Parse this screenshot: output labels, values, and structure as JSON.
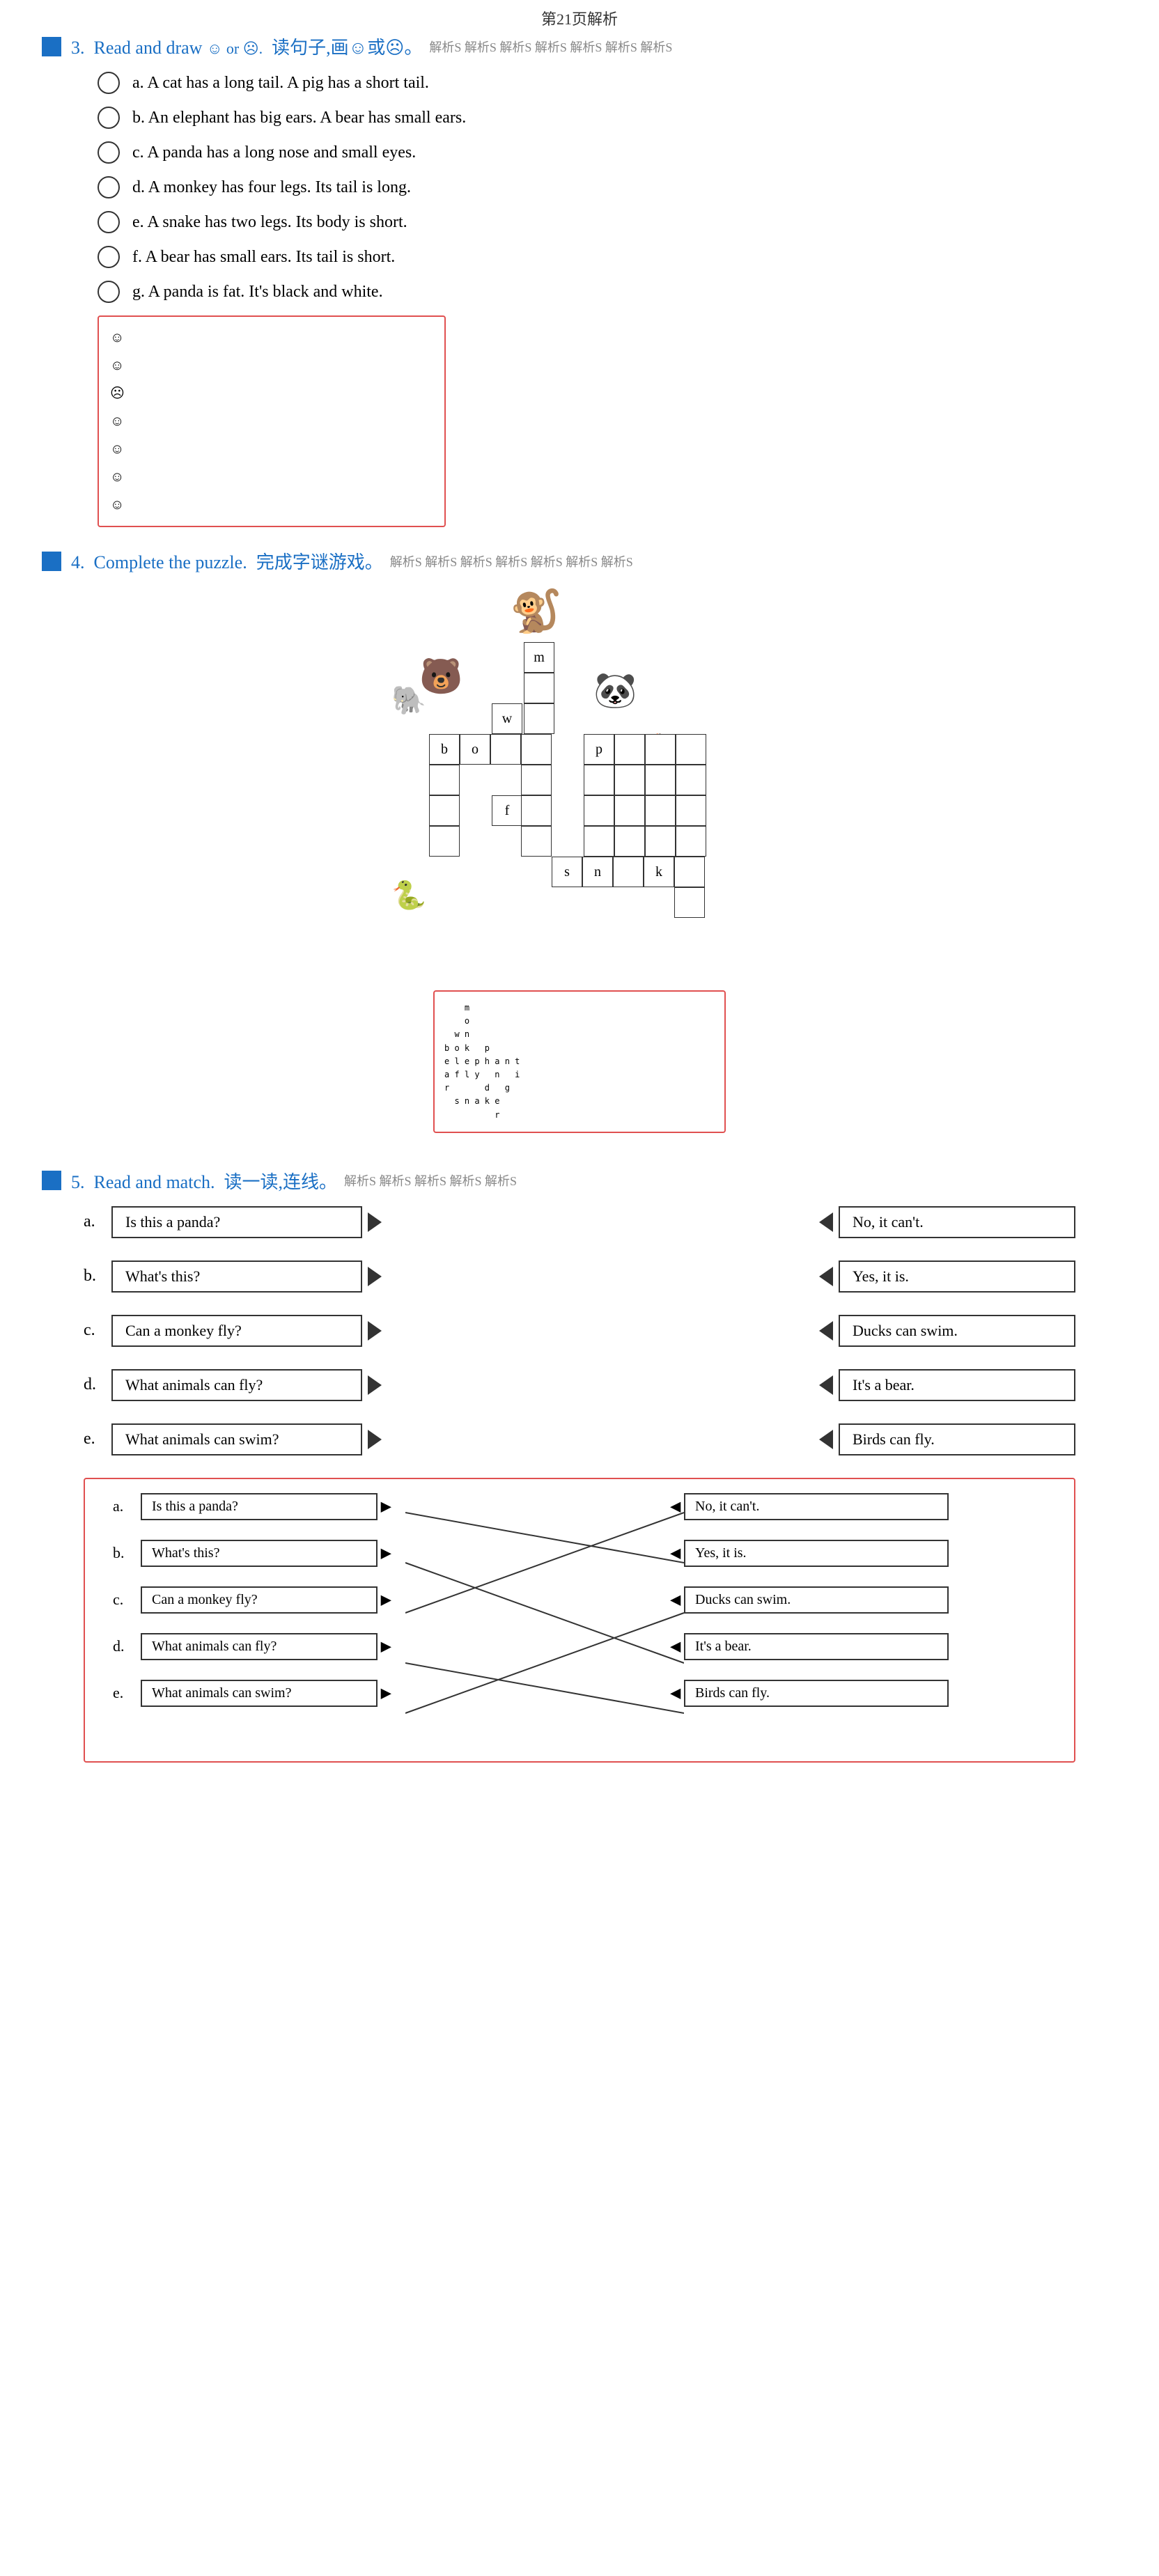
{
  "page": {
    "title": "第21页解析"
  },
  "section3": {
    "number": "3.",
    "title": "Read and draw",
    "symbols": "☺ or ☹.",
    "cn_title": "读句子,画☺或☹。",
    "decorative": "解析S 解析S 解析S 解析S 解析S 解析S 解析S",
    "sentences": [
      {
        "label": "a.",
        "text": "A cat has a long tail.  A pig has a short tail."
      },
      {
        "label": "b.",
        "text": "An elephant has big ears.  A bear has small ears."
      },
      {
        "label": "c.",
        "text": "A panda has a long nose and small eyes."
      },
      {
        "label": "d.",
        "text": "A monkey has four legs.  Its tail is long."
      },
      {
        "label": "e.",
        "text": "A snake has two legs.  Its body is short."
      },
      {
        "label": "f.",
        "text": "A bear has small ears.  Its tail is short."
      },
      {
        "label": "g.",
        "text": "A panda is fat.  It's black and white."
      }
    ],
    "answer_emojis": [
      "☺",
      "☺",
      "☹",
      "☺",
      "☺",
      "☺",
      "☺"
    ]
  },
  "section4": {
    "number": "4.",
    "title": "Complete the puzzle.",
    "cn_title": "完成字谜游戏。",
    "decorative": "解析S 解析S 解析S 解析S 解析S 解析S 解析S",
    "cells": {
      "m_col": 5,
      "w_col": 4,
      "bo_row": 3,
      "p_col": 7,
      "f_col": 4,
      "snk_row": 7
    }
  },
  "section5": {
    "number": "5.",
    "title": "Read and match.",
    "cn_title": "读一读,连线。",
    "decorative": "解析S 解析S 解析S 解析S 解析S",
    "questions": [
      {
        "label": "a.",
        "text": "Is this a panda?"
      },
      {
        "label": "b.",
        "text": "What's this?"
      },
      {
        "label": "c.",
        "text": "Can a monkey fly?"
      },
      {
        "label": "d.",
        "text": "What animals can fly?"
      },
      {
        "label": "e.",
        "text": "What animals can swim?"
      }
    ],
    "answers": [
      {
        "text": "No, it can't."
      },
      {
        "text": "Yes, it is."
      },
      {
        "text": "Ducks can swim."
      },
      {
        "text": "It's a bear."
      },
      {
        "text": "Birds can fly."
      }
    ],
    "answer_matches": {
      "a_to": 1,
      "b_to": 3,
      "c_to": 0,
      "d_to": 4,
      "e_to": 2
    }
  }
}
